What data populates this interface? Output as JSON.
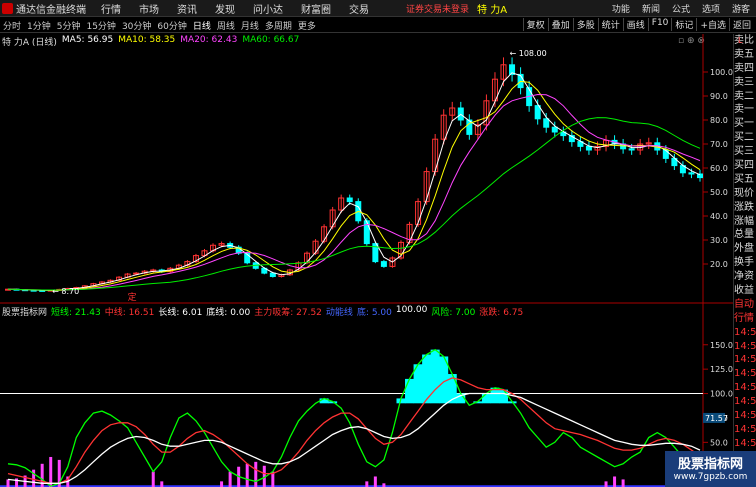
{
  "titlebar": {
    "app": "通达信金融终端",
    "menus": [
      "行情",
      "市场",
      "资讯",
      "发现",
      "问小达",
      "财富圈",
      "交易"
    ],
    "login": "证券交易未登录",
    "stock": "特 力A",
    "right": [
      "功能",
      "新闻",
      "公式",
      "选项",
      "游客"
    ]
  },
  "periods": [
    {
      "l": "分时",
      "a": false
    },
    {
      "l": "1分钟",
      "a": false
    },
    {
      "l": "5分钟",
      "a": false
    },
    {
      "l": "15分钟",
      "a": false
    },
    {
      "l": "30分钟",
      "a": false
    },
    {
      "l": "60分钟",
      "a": false
    },
    {
      "l": "日线",
      "a": true
    },
    {
      "l": "周线",
      "a": false
    },
    {
      "l": "月线",
      "a": false
    },
    {
      "l": "多周期",
      "a": false
    },
    {
      "l": "更多",
      "a": false
    }
  ],
  "tools": [
    "复权",
    "叠加",
    "多股",
    "统计",
    "画线",
    "F10",
    "标记",
    "+自选",
    "返回"
  ],
  "main_legend": {
    "name": "特 力A (日线)",
    "ma5": "MA5: 56.95",
    "ma10": "MA10: 58.35",
    "ma20": "MA20: 62.43",
    "ma60": "MA60: 66.67"
  },
  "colors": {
    "ma5": "#ffffff",
    "ma10": "#ffff00",
    "ma20": "#ff44ff",
    "ma60": "#00ee00",
    "up": "#ff3333",
    "down": "#00ffff",
    "cyan": "#00ffff",
    "magenta": "#ff44ff"
  },
  "ind_legend": [
    {
      "t": "股票指标网",
      "c": "#dddddd"
    },
    {
      "t": "短线: 21.43",
      "c": "#00ff00"
    },
    {
      "t": "中线: 16.51",
      "c": "#ff3333"
    },
    {
      "t": "长线: 6.01",
      "c": "#ffffff"
    },
    {
      "t": "底线: 0.00",
      "c": "#ffffff"
    },
    {
      "t": "主力吸筹: 27.52",
      "c": "#ff3333"
    },
    {
      "t": "动能线",
      "c": "#4466ff"
    },
    {
      "t": "底: 5.00",
      "c": "#4466ff"
    },
    {
      "t": "100.00",
      "c": "#ffffff"
    },
    {
      "t": "风险: 7.00",
      "c": "#00ff00"
    },
    {
      "t": "涨跌: 6.75",
      "c": "#ff3333"
    }
  ],
  "right_panel": [
    "卖比",
    "卖五",
    "卖四",
    "卖三",
    "卖二",
    "卖一",
    "买一",
    "买二",
    "买三",
    "买四",
    "买五",
    "现价",
    "涨跌",
    "涨幅",
    "总量",
    "外盘",
    "换手",
    "净资",
    "收益",
    "自动",
    "行情",
    "14:56",
    "14:56",
    "14:56",
    "14:56",
    "14:56",
    "14:56",
    "14:56",
    "14:56",
    "14:56",
    "14:56"
  ],
  "right_mark": "L",
  "chart_data": [
    {
      "type": "candlestick",
      "title": "特 力A (日线)",
      "y_ticks": [
        20,
        30,
        40,
        50,
        60,
        70,
        80,
        90,
        100
      ],
      "annotations": [
        {
          "label": "108.00"
        },
        {
          "label": "8.70"
        },
        {
          "label": "定"
        }
      ],
      "closes": [
        9.5,
        9.3,
        9.1,
        9.0,
        8.9,
        9.1,
        9.4,
        9.8,
        10.2,
        10.9,
        11.8,
        12.5,
        13.2,
        14.5,
        15.8,
        16.2,
        17.0,
        17.5,
        16.8,
        18.2,
        19.5,
        21.0,
        23.5,
        25.5,
        27.8,
        28.5,
        27.0,
        24.5,
        20.5,
        18.2,
        16.2,
        14.8,
        15.5,
        17.5,
        20.5,
        24.5,
        29.5,
        35.5,
        42.5,
        47.5,
        46.0,
        38.0,
        28.5,
        21.0,
        19.0,
        22.5,
        29.0,
        36.5,
        46.0,
        58.5,
        72.0,
        82.0,
        85.0,
        80.0,
        74.0,
        78.0,
        88.0,
        97.0,
        103.0,
        99.0,
        93.5,
        86.0,
        80.5,
        77.0,
        75.0,
        73.5,
        71.0,
        69.0,
        67.5,
        69.0,
        71.5,
        70.0,
        68.0,
        67.5,
        70.0,
        70.5,
        67.5,
        64.0,
        61.0,
        58.0,
        57.5,
        56.0
      ]
    },
    {
      "type": "line",
      "title": "股票指标网",
      "y_ticks": [
        50,
        75,
        100,
        125,
        150
      ],
      "series": [
        {
          "name": "短线",
          "values": [
            28,
            27,
            24,
            18,
            12,
            5,
            8,
            25,
            55,
            70,
            80,
            82,
            78,
            72,
            65,
            50,
            35,
            20,
            30,
            55,
            75,
            80,
            72,
            60,
            45,
            30,
            20,
            15,
            12,
            10,
            14,
            20,
            35,
            55,
            72,
            82,
            90,
            95,
            92,
            85,
            70,
            48,
            30,
            25,
            32,
            60,
            95,
            115,
            130,
            140,
            145,
            138,
            120,
            100,
            88,
            92,
            100,
            106,
            104,
            92,
            80,
            65,
            55,
            45,
            50,
            60,
            55,
            45,
            40,
            35,
            30,
            25,
            28,
            35,
            40,
            55,
            60,
            55,
            45,
            35,
            28,
            22
          ]
        },
        {
          "name": "中线",
          "values": [
            18,
            16,
            14,
            12,
            10,
            8,
            8,
            12,
            25,
            40,
            52,
            62,
            68,
            70,
            70,
            66,
            58,
            48,
            40,
            40,
            46,
            54,
            60,
            62,
            58,
            52,
            44,
            36,
            28,
            22,
            18,
            18,
            22,
            30,
            40,
            52,
            62,
            70,
            76,
            80,
            80,
            74,
            64,
            54,
            48,
            50,
            58,
            70,
            82,
            94,
            104,
            112,
            116,
            114,
            110,
            106,
            104,
            104,
            104,
            100,
            94,
            86,
            78,
            70,
            64,
            62,
            60,
            58,
            55,
            52,
            48,
            44,
            42,
            42,
            44,
            48,
            52,
            54,
            52,
            48,
            42,
            36
          ]
        },
        {
          "name": "长线",
          "values": [
            12,
            11,
            10,
            9,
            8,
            8,
            8,
            10,
            15,
            22,
            30,
            38,
            45,
            50,
            54,
            56,
            55,
            52,
            48,
            46,
            46,
            48,
            50,
            52,
            52,
            50,
            46,
            42,
            38,
            34,
            30,
            28,
            28,
            30,
            34,
            40,
            46,
            52,
            58,
            62,
            65,
            66,
            64,
            60,
            56,
            54,
            55,
            58,
            64,
            72,
            80,
            88,
            94,
            98,
            100,
            100,
            100,
            100,
            100,
            98,
            96,
            92,
            88,
            84,
            80,
            76,
            72,
            68,
            64,
            60,
            56,
            52,
            50,
            48,
            47,
            47,
            48,
            49,
            49,
            48,
            46,
            42
          ]
        }
      ]
    }
  ]
}
